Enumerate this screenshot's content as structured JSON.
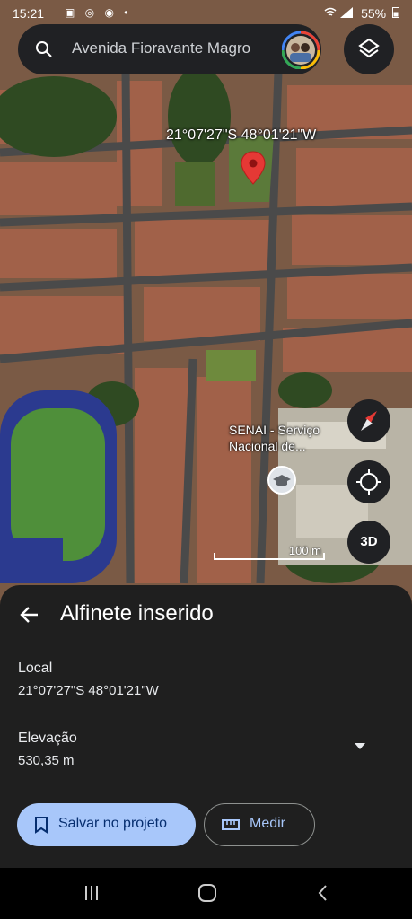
{
  "status_bar": {
    "time": "15:21",
    "battery": "55%",
    "notification_icons": "▣ ◎ ◉ •",
    "signal_icons": "wifi-icon lte-icon signal-icon"
  },
  "search": {
    "query": "Avenida Fioravante Magro"
  },
  "map": {
    "pin_coordinates": "21°07'27\"S 48°01'21\"W",
    "poi_label": "SENAI - Serviço Nacional de...",
    "scale_label": "100 m",
    "pin_color": "#e53935"
  },
  "controls": {
    "view_3d": "3D"
  },
  "sheet": {
    "title": "Alfinete inserido",
    "local_label": "Local",
    "local_value": "21°07'27\"S 48°01'21\"W",
    "elevation_label": "Elevação",
    "elevation_value": "530,35 m",
    "save_button": "Salvar no projeto",
    "measure_button": "Medir"
  },
  "colors": {
    "accent": "#a8c7fa",
    "sheet_bg": "#1f1f1f",
    "control_bg": "#202124"
  }
}
